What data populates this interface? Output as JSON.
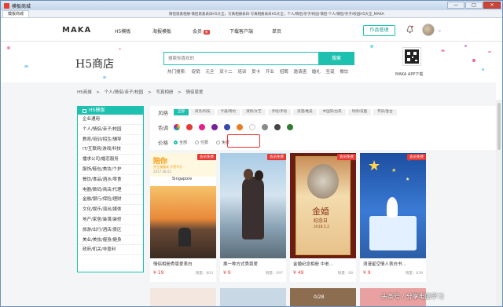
{
  "window": {
    "title": "模板商城",
    "min": "—",
    "max": "□",
    "close": "✕"
  },
  "tabbar": {
    "tab": "模板商城",
    "url": "情侣恩爱相册·情侣恩爱表白H5大全，写真相册表白·写真相册表白H5大全，个人/情侣/亲子/校园·情侣·个人/情侣/亲子/校园H5大全_MAKA"
  },
  "nav": {
    "logo": "MAKA",
    "links": [
      "H5模板",
      "海报模板",
      "会员",
      "下载客户端",
      "单页"
    ],
    "member_badge": "新",
    "manage_button": "作品管理"
  },
  "hero": {
    "title": "H5商店",
    "search_placeholder": "搜索你喜欢的",
    "search_button": "搜索",
    "hot_label": "热门搜索:",
    "hot_terms": [
      "促销",
      "元旦",
      "双十二",
      "培训",
      "贺卡",
      "开业",
      "招聘",
      "邀请函",
      "婚礼",
      "圣诞",
      "餐饮"
    ],
    "qr_label": "MAKA APP下载"
  },
  "breadcrumb": [
    "H5商城",
    ">",
    "个人/情侣/亲子/校园",
    ">",
    "写真相册",
    ">",
    "情侣恩爱"
  ],
  "sidebar": {
    "head": "H5模版",
    "items": [
      "企业通用",
      "个人/情侣/亲子/校园",
      "教育/培训/招生/辅导",
      "IT/互联网/游戏/科技",
      "播求公司/婚恋服务",
      "服饰/鞋包/美妆/个护",
      "餐饮/食品/酒水/零食",
      "电器/数码/商店/代理",
      "金融/银行/保险/理财",
      "文化/娱乐/演出/媒体",
      "地产/家居/装潢/装修",
      "旅游/出行/酒店/景区",
      "美业/美妆/瘦身/健身",
      "政府/机关/非盈利"
    ]
  },
  "filters": {
    "style_label": "风格",
    "styles": [
      "全部",
      "商务/科技",
      "卡通/简约",
      "清新/文艺",
      "手绘/手绘",
      "浪漫/唯美",
      "中国风/古风",
      "时尚/炫酷",
      "怀旧/复古"
    ],
    "color_label": "色调",
    "colors": [
      "#d9e0f2",
      "#e53935",
      "#e91e8c",
      "#7b1fa2",
      "#3949ab",
      "#e67e22",
      "#ffffff",
      "#8a8a8a",
      "#444444",
      "#2e7d32"
    ],
    "price_label": "价格",
    "prices": [
      "全部",
      "付费",
      "免费"
    ]
  },
  "cards": [
    {
      "tag": "会员免费",
      "title": "情侣相册秀恩爱表白",
      "price": "¥ 19",
      "sales": "销量：803"
    },
    {
      "tag": "会员免费",
      "title": "换一种方式秀恩爱",
      "price": "¥ 9",
      "sales": "销量：697"
    },
    {
      "tag": "会员免费",
      "title": "金婚纪念相册 中老...",
      "price": "¥ 49",
      "sales": "销量：68"
    },
    {
      "tag": "会员免费",
      "title": "浪漫星空情人表白书...",
      "price": "¥ 9",
      "sales": "销量：839"
    }
  ],
  "card1_text": {
    "head": "陪你",
    "line": "余生慢慢来 不慌不忙",
    "date": "2017.08.02",
    "place": "Singapore"
  },
  "card3_text": {
    "big": "金婚",
    "sub": "纪念日",
    "date": "2018.5.2"
  },
  "row2_text": "0/28",
  "watermark": "头条号 / 分享电脑学习"
}
